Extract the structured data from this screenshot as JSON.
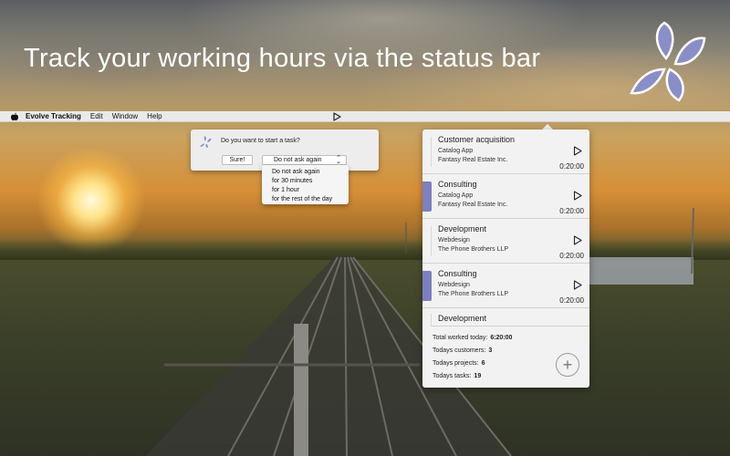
{
  "hero": {
    "title": "Track your working hours via the status bar"
  },
  "menubar": {
    "apple_icon": "apple-icon",
    "app_name": "Evolve Tracking",
    "items": [
      "Edit",
      "Window",
      "Help"
    ],
    "status_icon": "play-icon"
  },
  "prompt": {
    "question": "Do you want to start a task?",
    "confirm_label": "Sure!",
    "select_value": "Do not ask again",
    "options": [
      "Do not ask again",
      "for 30 minutes",
      "for 1 hour",
      "for the rest of the day"
    ]
  },
  "panel": {
    "tasks": [
      {
        "name": "Customer acquisition",
        "project": "Catalog App",
        "customer": "Fantasy Real Estate Inc.",
        "time": "0:20:00",
        "active": false
      },
      {
        "name": "Consulting",
        "project": "Catalog App",
        "customer": "Fantasy Real Estate Inc.",
        "time": "0:20:00",
        "active": true
      },
      {
        "name": "Development",
        "project": "Webdesign",
        "customer": "The Phone Brothers LLP",
        "time": "0:20:00",
        "active": false
      },
      {
        "name": "Consulting",
        "project": "Webdesign",
        "customer": "The Phone Brothers LLP",
        "time": "0:20:00",
        "active": true
      },
      {
        "name": "Development"
      }
    ],
    "stats": {
      "total_label": "Total worked today:",
      "total_value": "6:20:00",
      "customers_label": "Todays customers:",
      "customers_value": "3",
      "projects_label": "Todays projects:",
      "projects_value": "6",
      "tasks_label": "Todays tasks:",
      "tasks_value": "19"
    },
    "add_label": "+"
  },
  "colors": {
    "accent": "#7c80c0",
    "logo": "#8a8ec8"
  }
}
